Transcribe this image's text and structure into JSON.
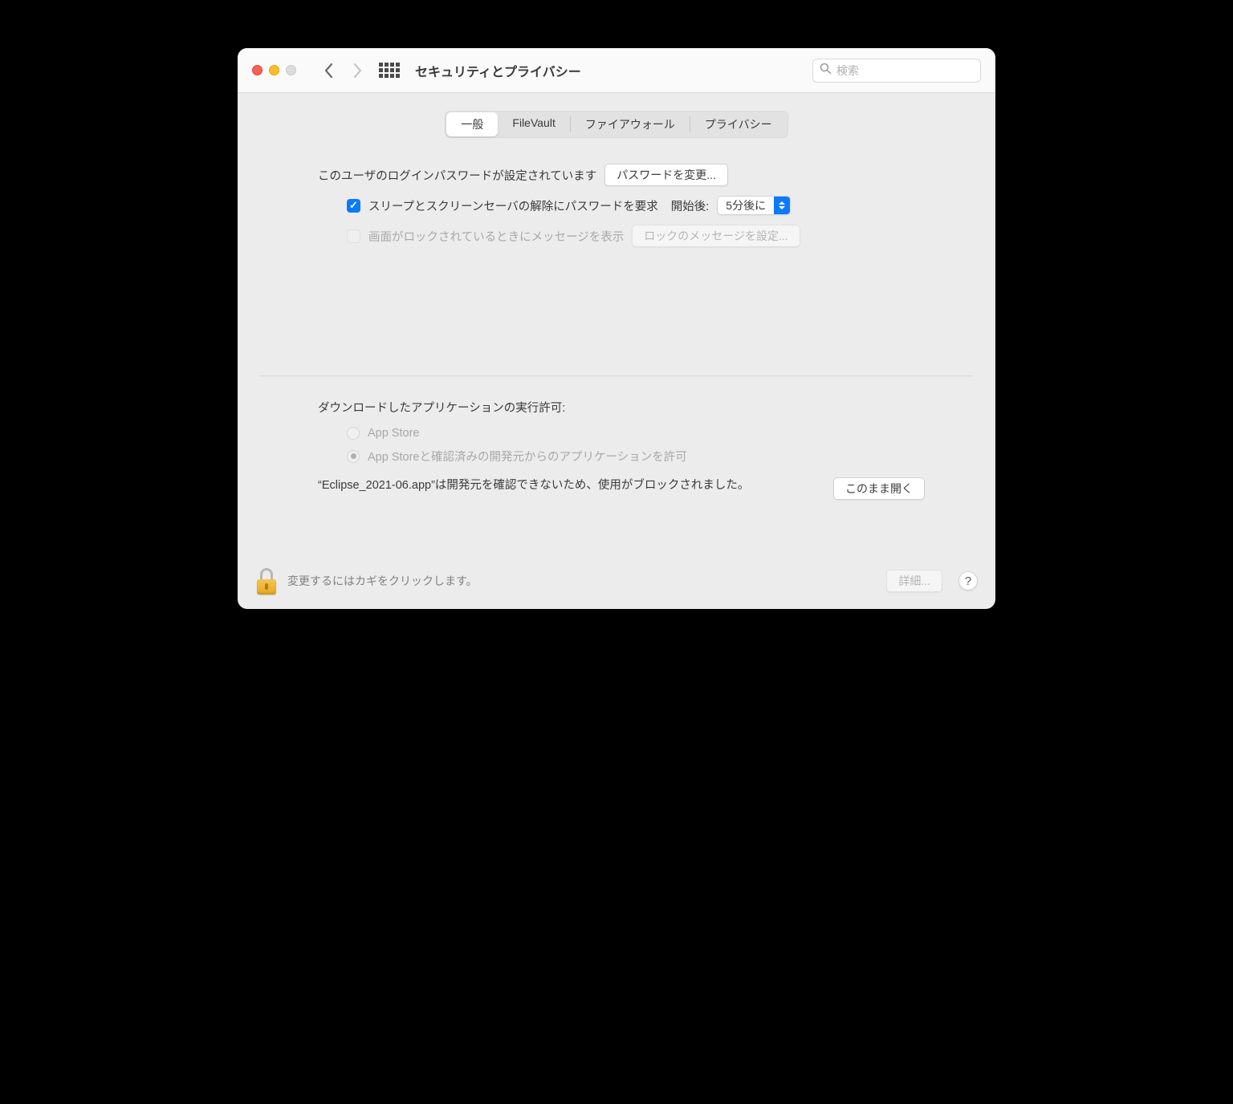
{
  "window": {
    "title": "セキュリティとプライバシー"
  },
  "search": {
    "placeholder": "検索"
  },
  "tabs": {
    "general": "一般",
    "filevault": "FileVault",
    "firewall": "ファイアウォール",
    "privacy": "プライバシー"
  },
  "general": {
    "password_set_label": "このユーザのログインパスワードが設定されています",
    "change_password_btn": "パスワードを変更...",
    "require_password_label": "スリープとスクリーンセーバの解除にパスワードを要求",
    "after_label": "開始後:",
    "delay_selected": "5分後に",
    "lock_message_label": "画面がロックされているときにメッセージを表示",
    "set_lock_message_btn": "ロックのメッセージを設定..."
  },
  "downloads": {
    "heading": "ダウンロードしたアプリケーションの実行許可:",
    "app_store": "App Store",
    "identified": "App Storeと確認済みの開発元からのアプリケーションを許可",
    "blocked_message": "“Eclipse_2021-06.app”は開発元を確認できないため、使用がブロックされました。",
    "open_anyway_btn": "このまま開く"
  },
  "footer": {
    "lock_text": "変更するにはカギをクリックします。",
    "advanced_btn": "詳細...",
    "help": "?"
  }
}
